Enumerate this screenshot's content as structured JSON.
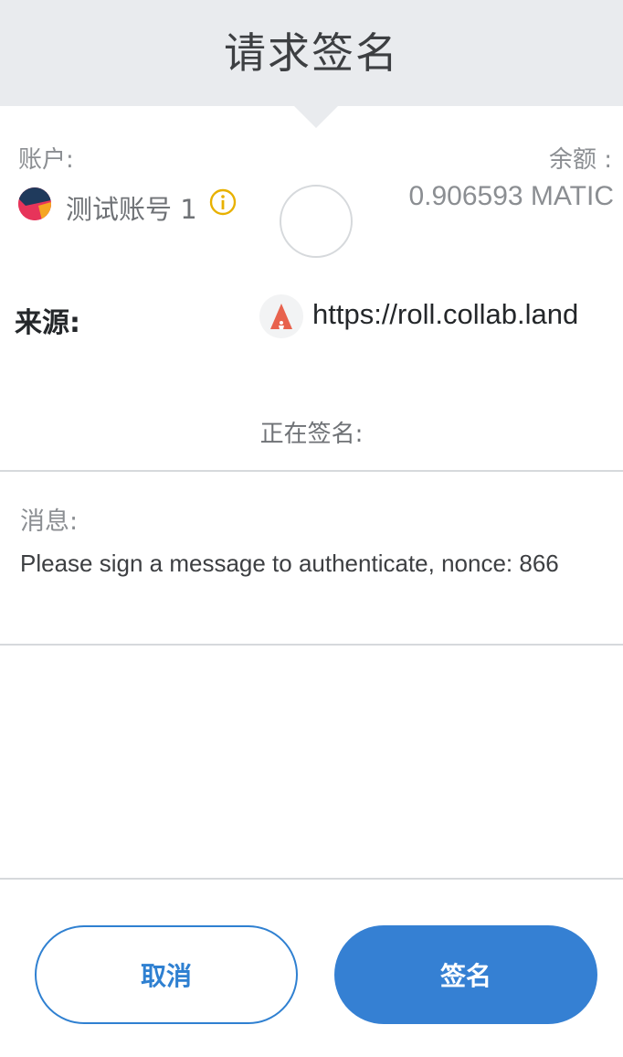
{
  "header": {
    "title": "请求签名"
  },
  "account": {
    "label": "账户:",
    "name": "测试账号 1",
    "info_icon": "info-icon"
  },
  "balance": {
    "label": "余额 :",
    "value": "0.906593 MATIC"
  },
  "origin": {
    "label": "来源:",
    "url": "https://roll.collab.land",
    "icon": "collab-land-icon"
  },
  "signing": {
    "label": "正在签名:"
  },
  "message": {
    "label": "消息:",
    "text": "Please sign a message to authenticate, nonce: 866"
  },
  "buttons": {
    "cancel": "取消",
    "sign": "签名"
  },
  "colors": {
    "header_bg": "#e9ebee",
    "primary": "#3580d3",
    "info": "#e8b100",
    "origin_icon": "#e8624d"
  }
}
